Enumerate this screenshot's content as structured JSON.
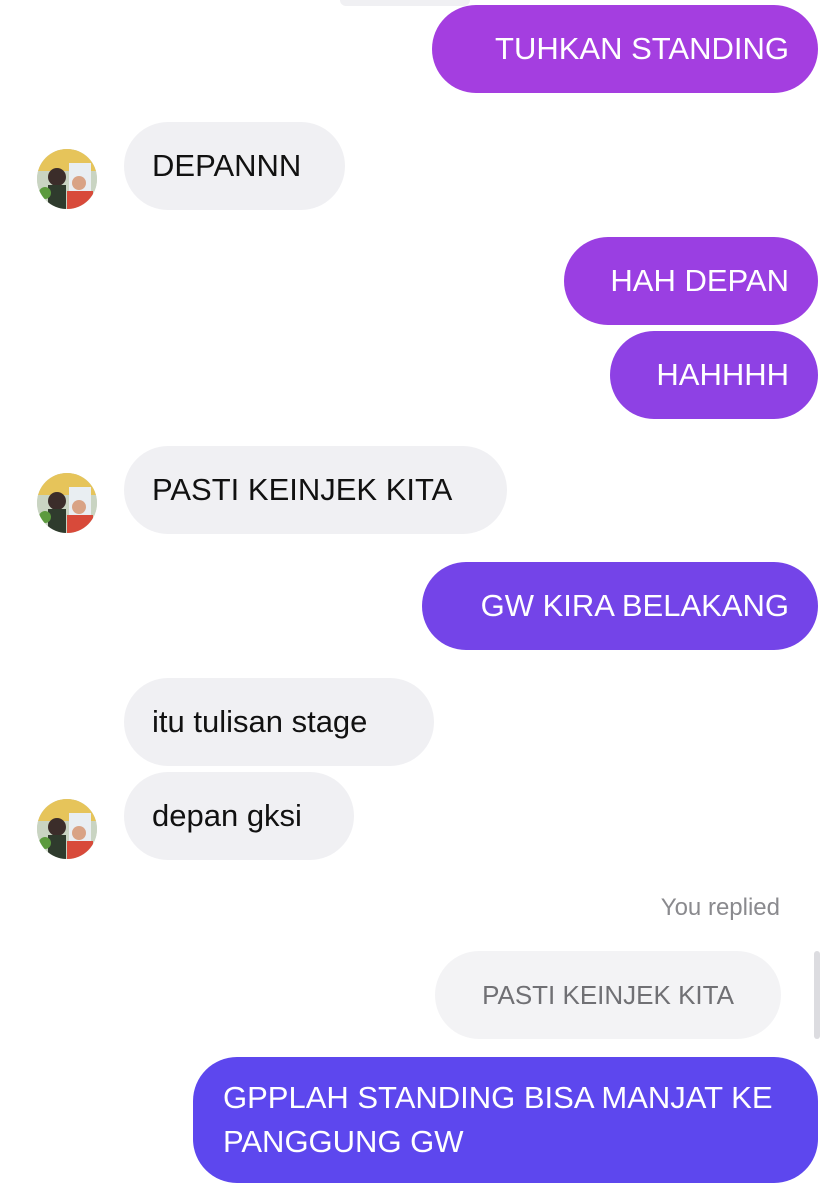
{
  "messages": {
    "m1": {
      "text": "TUHKAN STANDING",
      "color": "#a43ee0"
    },
    "m2": {
      "text": "DEPANNN"
    },
    "m3": {
      "text": "HAH DEPAN",
      "color": "#9a3fe2"
    },
    "m4": {
      "text": "HAHHHH",
      "color": "#8e41e4"
    },
    "m5": {
      "text": "PASTI KEINJEK KITA"
    },
    "m6": {
      "text": "GW KIRA BELAKANG",
      "color": "#7444e8"
    },
    "m7": {
      "text": "itu tulisan stage"
    },
    "m8": {
      "text": "depan gksi"
    },
    "reply": {
      "label": "You replied",
      "quoted_text": "PASTI KEINJEK KITA",
      "text": "GPPLAH STANDING BISA MANJAT KE PANGGUNG GW",
      "color": "#5d47ee"
    }
  },
  "icons": {
    "avatar": "contact-avatar-icon"
  }
}
